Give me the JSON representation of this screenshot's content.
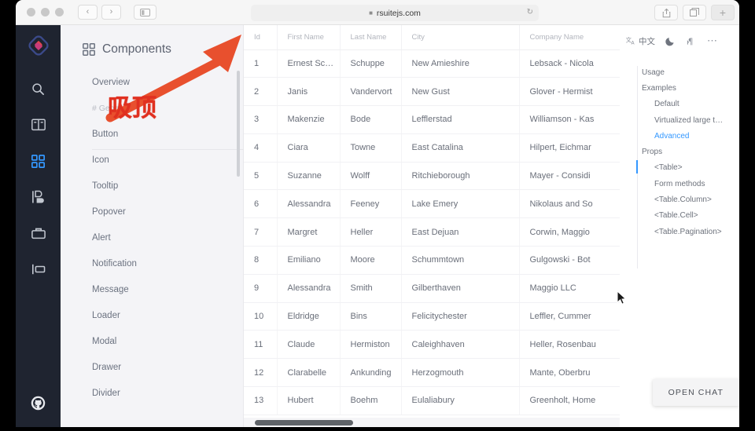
{
  "browser": {
    "url": "rsuitejs.com",
    "lock_icon": "lock-icon",
    "back_label": "‹",
    "forward_label": "›",
    "reload_label": "↻",
    "new_tab_label": "+",
    "share_icon": "share-icon",
    "tabs_icon": "tabs-overview-icon"
  },
  "rail": {
    "logo": "rsuite-logo",
    "items": [
      {
        "name": "search-icon"
      },
      {
        "name": "guide-book-icon"
      },
      {
        "name": "components-grid-icon",
        "active": true
      },
      {
        "name": "design-palette-icon"
      },
      {
        "name": "tools-icon"
      },
      {
        "name": "extensions-icon"
      }
    ],
    "github": "github-icon"
  },
  "docs_nav": {
    "title": "Components",
    "title_icon": "grid-icon",
    "items": [
      {
        "label": "Overview",
        "type": "item"
      },
      {
        "label": "# General",
        "type": "section"
      },
      {
        "label": "Button",
        "type": "item"
      },
      {
        "label": "Icon",
        "type": "item"
      },
      {
        "label": "Tooltip",
        "type": "item"
      },
      {
        "label": "Popover",
        "type": "item"
      },
      {
        "label": "Alert",
        "type": "item"
      },
      {
        "label": "Notification",
        "type": "item"
      },
      {
        "label": "Message",
        "type": "item"
      },
      {
        "label": "Loader",
        "type": "item"
      },
      {
        "label": "Modal",
        "type": "item"
      },
      {
        "label": "Drawer",
        "type": "item"
      },
      {
        "label": "Divider",
        "type": "item"
      }
    ]
  },
  "table": {
    "columns": [
      "Id",
      "First Name",
      "Last Name",
      "City",
      "Company Name"
    ],
    "rows": [
      [
        "1",
        "Ernest Sc…",
        "Schuppe",
        "New Amieshire",
        "Lebsack - Nicola"
      ],
      [
        "2",
        "Janis",
        "Vandervort",
        "New Gust",
        "Glover - Hermist"
      ],
      [
        "3",
        "Makenzie",
        "Bode",
        "Lefflerstad",
        "Williamson - Kas"
      ],
      [
        "4",
        "Ciara",
        "Towne",
        "East Catalina",
        "Hilpert, Eichmar"
      ],
      [
        "5",
        "Suzanne",
        "Wolff",
        "Ritchieborough",
        "Mayer - Considi"
      ],
      [
        "6",
        "Alessandra",
        "Feeney",
        "Lake Emery",
        "Nikolaus and So"
      ],
      [
        "7",
        "Margret",
        "Heller",
        "East Dejuan",
        "Corwin, Maggio"
      ],
      [
        "8",
        "Emiliano",
        "Moore",
        "Schummtown",
        "Gulgowski - Bot"
      ],
      [
        "9",
        "Alessandra",
        "Smith",
        "Gilberthaven",
        "Maggio LLC"
      ],
      [
        "10",
        "Eldridge",
        "Bins",
        "Felicitychester",
        "Leffler, Cummer"
      ],
      [
        "11",
        "Claude",
        "Hermiston",
        "Caleighhaven",
        "Heller, Rosenbau"
      ],
      [
        "12",
        "Clarabelle",
        "Ankunding",
        "Herzogmouth",
        "Mante, Oberbru"
      ],
      [
        "13",
        "Hubert",
        "Boehm",
        "Eulaliabury",
        "Greenholt, Home"
      ]
    ]
  },
  "toc": {
    "tools": [
      {
        "name": "translate-icon",
        "label": "中文"
      },
      {
        "name": "dark-mode-moon-icon"
      },
      {
        "name": "rtl-direction-icon"
      },
      {
        "name": "more-options-icon",
        "label": "⋯"
      }
    ],
    "items": [
      {
        "label": "Usage",
        "level": 1
      },
      {
        "label": "Examples",
        "level": 1
      },
      {
        "label": "Default",
        "level": 2
      },
      {
        "label": "Virtualized large t…",
        "level": 2
      },
      {
        "label": "Advanced",
        "level": 2,
        "active": true
      },
      {
        "label": "Props",
        "level": 1
      },
      {
        "label": "<Table>",
        "level": 2
      },
      {
        "label": "Form methods",
        "level": 2
      },
      {
        "label": "<Table.Column>",
        "level": 2
      },
      {
        "label": "<Table.Cell>",
        "level": 2
      },
      {
        "label": "<Table.Pagination>",
        "level": 2
      }
    ]
  },
  "chat": {
    "label": "OPEN CHAT"
  },
  "annotation": {
    "text": "吸顶",
    "color": "#e03020"
  },
  "colors": {
    "accent": "#3498ff",
    "rail_bg": "#1f2430",
    "nav_bg": "#f4f4f7",
    "annotation": "#e03020"
  }
}
